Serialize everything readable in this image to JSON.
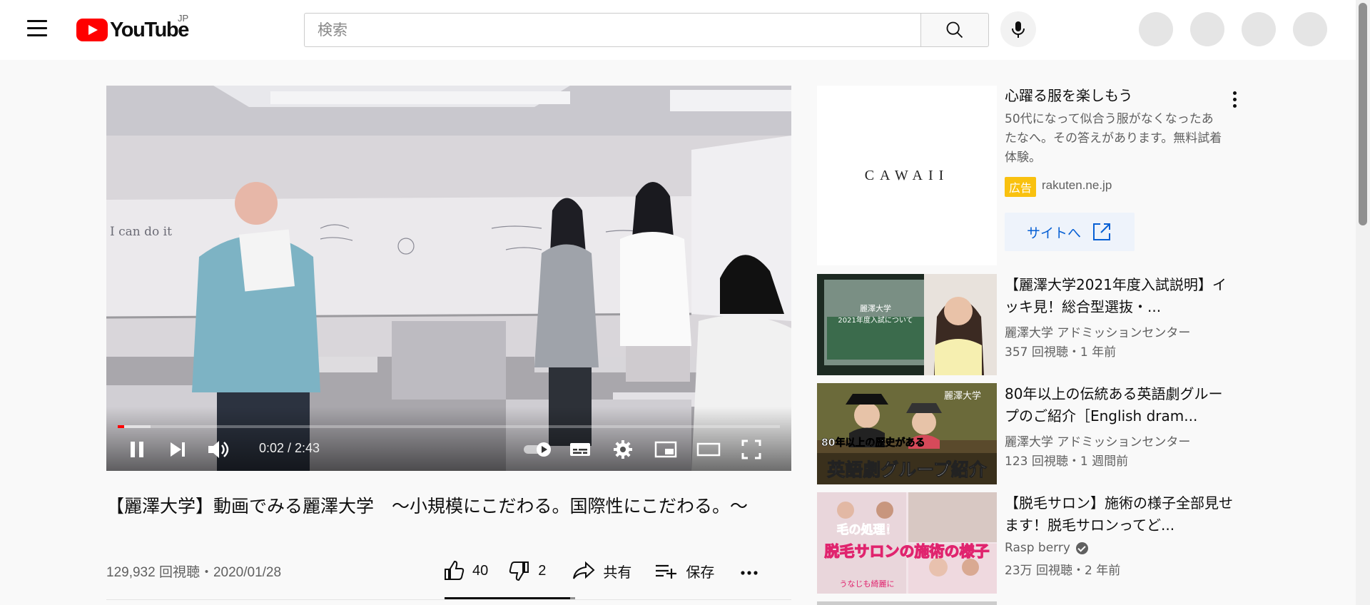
{
  "header": {
    "logo_text": "YouTube",
    "country_code": "JP",
    "search_placeholder": "検索"
  },
  "player": {
    "time_display": "0:02 / 2:43",
    "progress": {
      "played_fraction": 0.01,
      "buffered_fraction": 0.05
    },
    "classroom_whiteboard_text": "I can do it"
  },
  "video": {
    "title": "【麗澤大学】動画でみる麗澤大学　～小規模にこだわる。国際性にこだわる。～",
    "view_info": "129,932 回視聴・2020/01/28",
    "likes": "40",
    "dislikes": "2",
    "share_label": "共有",
    "save_label": "保存",
    "like_ratio": 0.952
  },
  "sidebar": {
    "ad": {
      "thumb_logo": "CAWAII",
      "title": "心躍る服を楽しもう",
      "description": "50代になって似合う服がなくなったあたなへ。その答えがあります。無料試着体験。",
      "badge": "広告",
      "domain": "rakuten.ne.jp",
      "site_button": "サイトへ"
    },
    "recommendations": [
      {
        "title": "【麗澤大学2021年度入試説明】イッキ見！総合型選抜・...",
        "channel": "麗澤大学 アドミッションセンター",
        "meta": "357 回視聴・1 年前",
        "verified": false,
        "thumb_text_1": "麗澤大学",
        "thumb_text_2": "2021年度入試について"
      },
      {
        "title": "80年以上の伝統ある英語劇グループのご紹介［English dram...",
        "channel": "麗澤大学 アドミッションセンター",
        "meta": "123 回視聴・1 週間前",
        "verified": false,
        "thumb_text_1": "80年以上の歴史がある",
        "thumb_text_2": "英語劇グループ紹介",
        "thumb_text_3": "麗澤大学"
      },
      {
        "title": "【脱毛サロン】施術の様子全部見せます！脱毛サロンってど...",
        "channel": "Rasp berry",
        "meta": "23万 回視聴・2 年前",
        "verified": true,
        "thumb_text_1": "毛の処理！",
        "thumb_text_2": "脱毛サロンの施術の様子",
        "thumb_text_3": "うなじも綺麗に"
      }
    ]
  }
}
